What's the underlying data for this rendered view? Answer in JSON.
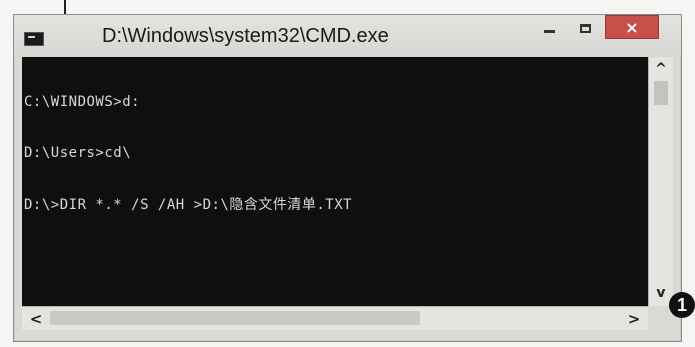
{
  "window": {
    "title": "D:\\Windows\\system32\\CMD.exe",
    "icon": "cmd-icon",
    "controls": {
      "minimize_icon": "minimize-icon",
      "maximize_icon": "maximize-icon",
      "close_label": "×"
    }
  },
  "console": {
    "lines": [
      "C:\\WINDOWS>d:",
      "D:\\Users>cd\\",
      "D:\\>DIR *.* /S /AH >D:\\隐含文件清单.TXT"
    ]
  },
  "scrollbars": {
    "vertical": {
      "up": "^",
      "down": "v"
    },
    "horizontal": {
      "left": "<",
      "right": ">"
    }
  },
  "annotation": {
    "step_number": "1"
  },
  "colors": {
    "console_background": "#0f0f0f",
    "console_text": "#d8d8d8",
    "close_button": "#c7504a"
  }
}
